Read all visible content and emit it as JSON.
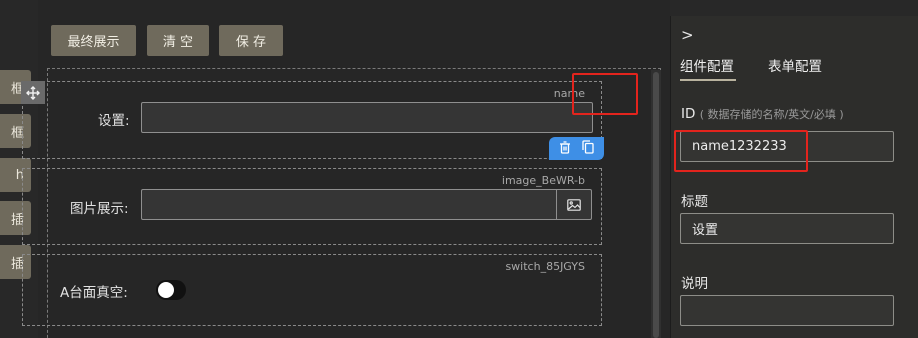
{
  "palette": {
    "items": [
      "框",
      "框",
      "h",
      "插",
      "插"
    ]
  },
  "toolbar": {
    "final_preview": "最终展示",
    "clear": "清 空",
    "save": "保 存"
  },
  "canvas": {
    "widgets": [
      {
        "field_id": "name",
        "label": "设置:",
        "type": "input"
      },
      {
        "field_id": "image_BeWR-b",
        "label": "图片展示:",
        "type": "image"
      },
      {
        "field_id": "switch_85JGYS",
        "label": "A台面真空:",
        "type": "switch",
        "checked": false
      }
    ],
    "move_icon": "move-icon",
    "action_icons": [
      "trash-icon",
      "copy-icon"
    ]
  },
  "panel": {
    "chevron": ">",
    "tabs": [
      {
        "label": "组件配置",
        "active": true
      },
      {
        "label": "表单配置",
        "active": false
      }
    ],
    "id_label": "ID",
    "id_hint": "( 数据存储的名称/英文/必填 )",
    "id_value": "name1232233",
    "title_label": "标题",
    "title_value": "设置",
    "desc_label": "说明",
    "desc_value": ""
  },
  "colors": {
    "accent_button": "#6f6a5c",
    "action_blue": "#3e8fe6",
    "highlight_red": "#e3241d"
  }
}
